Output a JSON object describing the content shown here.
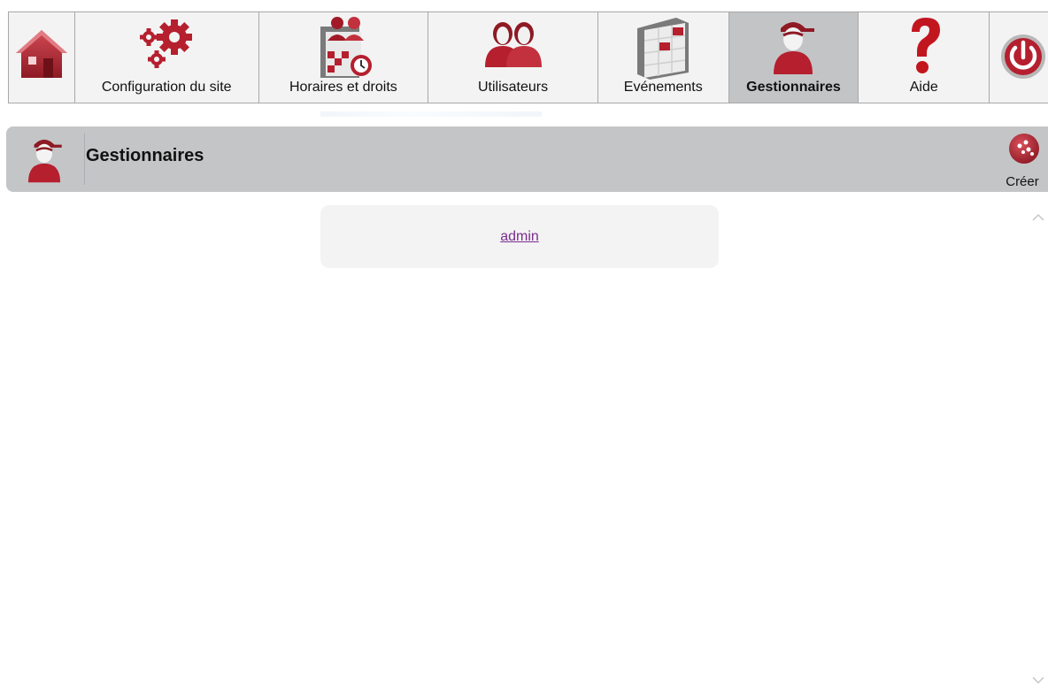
{
  "nav": {
    "items": [
      {
        "label": "",
        "icon": "home-icon"
      },
      {
        "label": "Configuration du site",
        "icon": "gears-icon"
      },
      {
        "label": "Horaires et droits",
        "icon": "schedule-icon"
      },
      {
        "label": "Utilisateurs",
        "icon": "users-icon"
      },
      {
        "label": "Evénements",
        "icon": "calendar-icon"
      },
      {
        "label": "Gestionnaires",
        "icon": "manager-icon",
        "active": true
      },
      {
        "label": "Aide",
        "icon": "help-icon"
      },
      {
        "label": "",
        "icon": "power-icon"
      }
    ]
  },
  "header": {
    "title": "Gestionnaires",
    "create_label": "Créer"
  },
  "managers": {
    "items": [
      "admin"
    ]
  },
  "colors": {
    "accent": "#b51f2e",
    "active_tab": "#c3c4c6",
    "header_bar": "#c4c5c7",
    "link": "#7b2d8e"
  }
}
